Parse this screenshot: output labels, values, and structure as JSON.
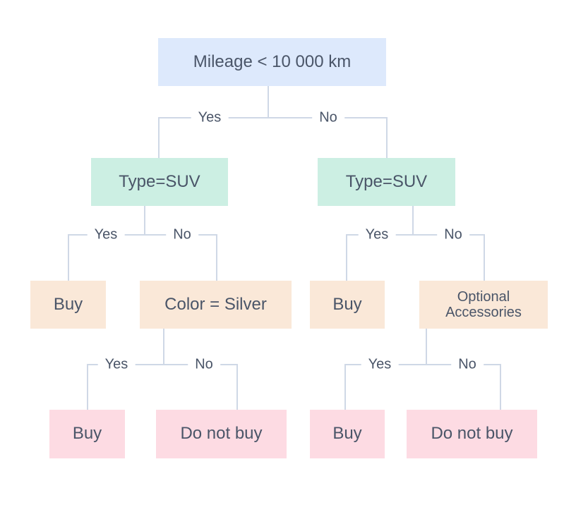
{
  "colors": {
    "decision_root": "#dde9fc",
    "decision": "#ccefe3",
    "intermediate": "#fae8d8",
    "leaf": "#fddbe3",
    "line": "#cfd8e6",
    "text": "#4a5568"
  },
  "nodes": {
    "root": "Mileage < 10 000 km",
    "left_type": "Type=SUV",
    "right_type": "Type=SUV",
    "left_buy": "Buy",
    "color": "Color = Silver",
    "right_buy": "Buy",
    "optional": "Optional Accessories",
    "color_yes": "Buy",
    "color_no": "Do not buy",
    "optional_yes": "Buy",
    "optional_no": "Do not buy"
  },
  "edges": {
    "root_yes": "Yes",
    "root_no": "No",
    "left_yes": "Yes",
    "left_no": "No",
    "right_yes": "Yes",
    "right_no": "No",
    "color_yes": "Yes",
    "color_no": "No",
    "optional_yes": "Yes",
    "optional_no": "No"
  }
}
